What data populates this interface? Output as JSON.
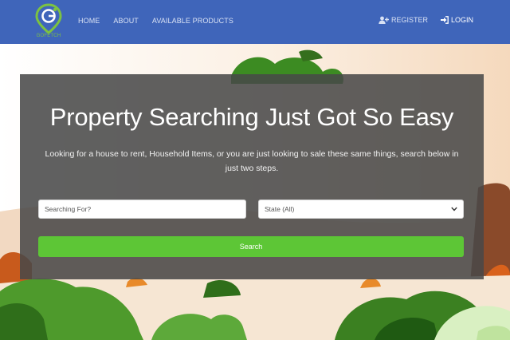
{
  "brand": {
    "logo_text": "GOFETCH"
  },
  "nav": {
    "links": [
      "HOME",
      "ABOUT",
      "AVAILABLE PRODUCTS"
    ],
    "register_label": "REGISTER",
    "login_label": "LOGIN"
  },
  "hero": {
    "headline": "Property Searching Just Got So Easy",
    "subtext": "Looking for a house to rent, Household Items, or you are just looking to sale these same things, search below in just two steps.",
    "search_placeholder": "Searching For?",
    "state_selected": "State (All)",
    "search_button": "Search"
  },
  "colors": {
    "navbar": "#3f65ba",
    "accent_green": "#5dc636",
    "panel_overlay": "rgba(72,72,72,0.87)"
  },
  "icons": {
    "register": "user-plus-icon",
    "login": "sign-in-icon",
    "state_dropdown": "chevron-down-icon"
  }
}
